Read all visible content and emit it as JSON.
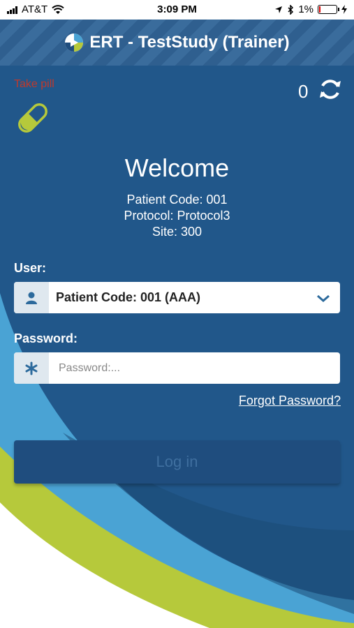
{
  "status_bar": {
    "carrier": "AT&T",
    "time": "3:09 PM",
    "battery": "1%",
    "icons": [
      "signal-icon",
      "wifi-icon",
      "location-icon",
      "bluetooth-icon",
      "battery-icon",
      "charging-icon"
    ]
  },
  "header": {
    "title": "ERT - TestStudy (Trainer)",
    "logo": "ert-logo-icon"
  },
  "reminder": {
    "label": "Take pill",
    "icon": "pill-icon",
    "color": "#c0392b"
  },
  "sync": {
    "count": "0",
    "icon": "sync-icon"
  },
  "welcome": {
    "title": "Welcome",
    "patient_code": "Patient Code: 001",
    "protocol": "Protocol: Protocol3",
    "site": "Site: 300"
  },
  "form": {
    "user_label": "User:",
    "user_value": "Patient Code: 001 (AAA)",
    "password_label": "Password:",
    "password_placeholder": "Password:...",
    "forgot_link": "Forgot Password?",
    "login_button": "Log in"
  },
  "colors": {
    "background": "#21578a",
    "accent_green": "#b6c93b",
    "accent_light_blue": "#4aa3d4",
    "header_stripe": "#3a6c9c"
  }
}
